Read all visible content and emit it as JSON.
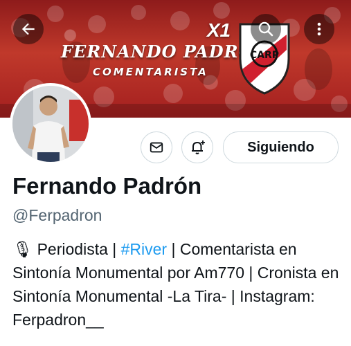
{
  "header": {
    "banner_title": "FERNANDO PADRÓN",
    "banner_subtitle": "COMENTARISTA",
    "badge_text": "X1",
    "club_crest_letters": "CARP"
  },
  "actions": {
    "follow_label": "Siguiendo"
  },
  "profile": {
    "name": "Fernando Padrón",
    "handle": "@Ferpadron",
    "bio": {
      "mic_emoji": "🎙",
      "part1": " Periodista | ",
      "hashtag": "#River",
      "part2": " | Comentarista en Sintonía Monumental por Am770 | Cronista en Sintonía Monumental -La Tira- | Instagram: Ferpadron__"
    }
  },
  "colors": {
    "banner_red": "#c0392b",
    "link_blue": "#1d9bf0",
    "text_dark": "#0f1419",
    "text_muted": "#536471"
  }
}
